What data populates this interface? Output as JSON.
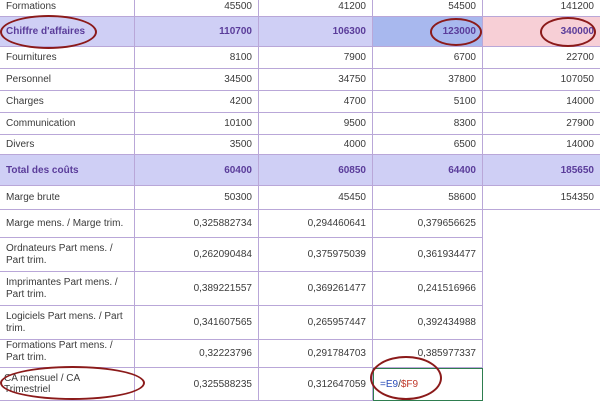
{
  "rows": [
    {
      "label": "Formations",
      "values": [
        "45500",
        "41200",
        "54500",
        "141200"
      ],
      "type": "normal"
    },
    {
      "label": "Chiffre d'affaires",
      "values": [
        "110700",
        "106300",
        "123000",
        "340000"
      ],
      "type": "highlight"
    },
    {
      "label": "Fournitures",
      "values": [
        "8100",
        "7900",
        "6700",
        "22700"
      ],
      "type": "normal"
    },
    {
      "label": "Personnel",
      "values": [
        "34500",
        "34750",
        "37800",
        "107050"
      ],
      "type": "normal"
    },
    {
      "label": "Charges",
      "values": [
        "4200",
        "4700",
        "5100",
        "14000"
      ],
      "type": "normal"
    },
    {
      "label": "Communication",
      "values": [
        "10100",
        "9500",
        "8300",
        "27900"
      ],
      "type": "normal"
    },
    {
      "label": "Divers",
      "values": [
        "3500",
        "4000",
        "6500",
        "14000"
      ],
      "type": "normal"
    },
    {
      "label": "Total des coûts",
      "values": [
        "60400",
        "60850",
        "64400",
        "185650"
      ],
      "type": "highlight"
    },
    {
      "label": "Marge brute",
      "values": [
        "50300",
        "45450",
        "58600",
        "154350"
      ],
      "type": "normal"
    },
    {
      "label": "Marge mens. / Marge trim.",
      "values": [
        "0,325882734",
        "0,294460641",
        "0,379656625",
        ""
      ],
      "type": "ratio"
    },
    {
      "label": "Ordnateurs Part mens. / Part trim.",
      "values": [
        "0,262090484",
        "0,375975039",
        "0,361934477",
        ""
      ],
      "type": "ratio"
    },
    {
      "label": "Imprimantes Part mens. / Part trim.",
      "values": [
        "0,389221557",
        "0,369261477",
        "0,241516966",
        ""
      ],
      "type": "ratio"
    },
    {
      "label": "Logiciels Part mens. / Part trim.",
      "values": [
        "0,341607565",
        "0,265957447",
        "0,392434988",
        ""
      ],
      "type": "ratio"
    },
    {
      "label": "Formations Part mens. / Part trim.",
      "values": [
        "0,32223796",
        "0,291784703",
        "0,385977337",
        ""
      ],
      "type": "ratio"
    },
    {
      "label": "CA mensuel / CA Trimestriel",
      "values": [
        "0,325588235",
        "0,312647059",
        "",
        ""
      ],
      "type": "ratio"
    }
  ],
  "formula": {
    "eq": "=",
    "ref1": "E9",
    "sep": "/",
    "ref2": "$F9"
  },
  "colors": {
    "highlight": "#cfcff5",
    "selected": "#a8b8ee",
    "pink": "#f7cfd6",
    "annotation": "#8b1a1a",
    "formula_border": "#2e7d4f"
  }
}
